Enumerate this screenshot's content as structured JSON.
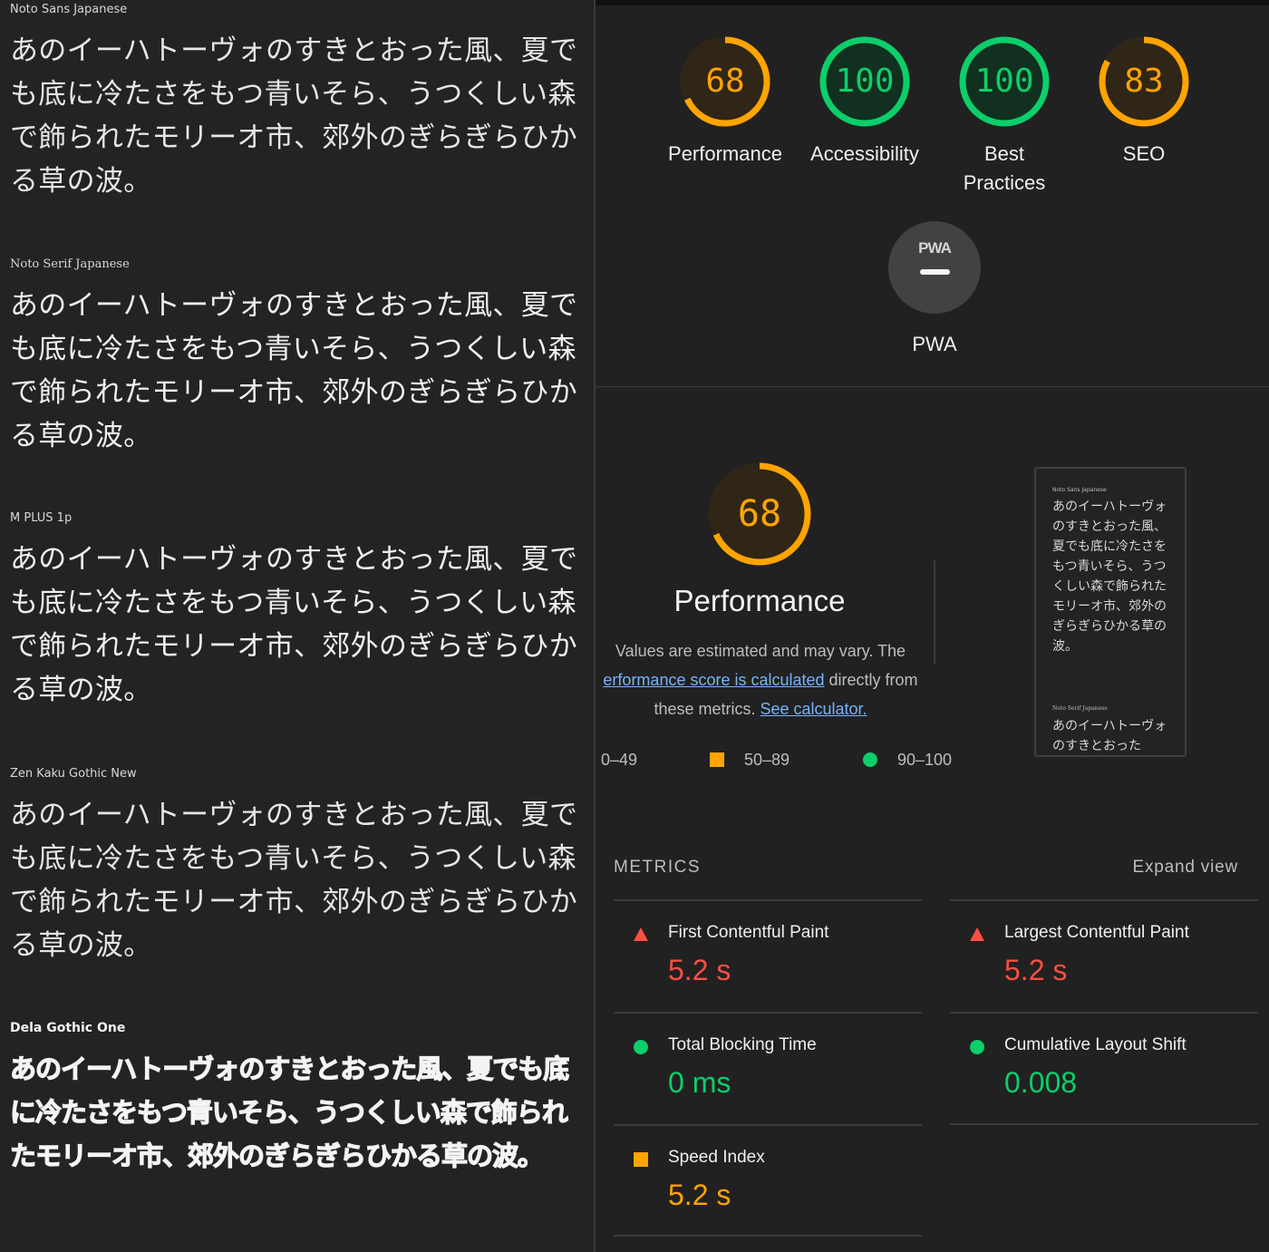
{
  "font_specimens": [
    {
      "font_name": "Noto Sans Japanese",
      "sample": "あのイーハトーヴォのすきとおった風、夏でも底に冷たさをもつ青いそら、うつくしい森で飾られたモリーオ市、郊外のぎらぎらひかる草の波。"
    },
    {
      "font_name": "Noto Serif Japanese",
      "sample": "あのイーハトーヴォのすきとおった風、夏でも底に冷たさをもつ青いそら、うつくしい森で飾られたモリーオ市、郊外のぎらぎらひかる草の波。"
    },
    {
      "font_name": "M PLUS 1p",
      "sample": "あのイーハトーヴォのすきとおった風、夏でも底に冷たさをもつ青いそら、うつくしい森で飾られたモリーオ市、郊外のぎらぎらひかる草の波。"
    },
    {
      "font_name": "Zen Kaku Gothic New",
      "sample": "あのイーハトーヴォのすきとおった風、夏でも底に冷たさをもつ青いそら、うつくしい森で飾られたモリーオ市、郊外のぎらぎらひかる草の波。"
    },
    {
      "font_name": "Dela Gothic One",
      "sample": "あのイーハトーヴォのすきとおった風、夏でも底に冷たさをもつ青いそら、うつくしい森で飾られたモリーオ市、郊外のぎらぎらひかる草の波。"
    }
  ],
  "report": {
    "categories": [
      {
        "label": "Performance",
        "score": "68",
        "score_value": 68,
        "rating": "average"
      },
      {
        "label": "Accessibility",
        "score": "100",
        "score_value": 100,
        "rating": "pass"
      },
      {
        "label": "Best Practices",
        "score": "100",
        "score_value": 100,
        "rating": "pass"
      },
      {
        "label": "SEO",
        "score": "83",
        "score_value": 83,
        "rating": "average"
      }
    ],
    "pwa": {
      "label": "PWA",
      "mark": "PWA"
    },
    "performance": {
      "score": "68",
      "score_value": 68,
      "title": "Performance",
      "desc_line1": "Values are estimated and may vary. The",
      "desc_link1": "erformance score is calculated",
      "desc_after_link1": " directly from",
      "desc_line3_prefix": "these metrics. ",
      "desc_link2": "See calculator.",
      "legend": [
        "0–49",
        "50–89",
        "90–100"
      ]
    },
    "screenshot_thumb": {
      "font_name_1": "Noto Sans Japanese",
      "text_1": "あのイーハトーヴォのすきとおった風、夏でも底に冷たさをもつ青いそら、うつくしい森で飾られたモリーオ市、郊外のぎらぎらひかる草の波。",
      "font_name_2": "Noto Serif Japanese",
      "text_2": "あのイーハトーヴォのすきとおった"
    },
    "metrics_heading": "METRICS",
    "expand_view": "Expand view",
    "metrics": [
      {
        "title": "First Contentful Paint",
        "value": "5.2 s",
        "rating": "fail",
        "icon": "triangle-icon"
      },
      {
        "title": "Largest Contentful Paint",
        "value": "5.2 s",
        "rating": "fail",
        "icon": "triangle-icon"
      },
      {
        "title": "Total Blocking Time",
        "value": "0 ms",
        "rating": "pass",
        "icon": "circle-icon"
      },
      {
        "title": "Cumulative Layout Shift",
        "value": "0.008",
        "rating": "pass",
        "icon": "circle-icon"
      },
      {
        "title": "Speed Index",
        "value": "5.2 s",
        "rating": "average",
        "icon": "square-icon"
      }
    ],
    "colors": {
      "fail": "#ff4e42",
      "average": "#ffa400",
      "pass": "#0cce6b",
      "link": "#76b3ff"
    }
  }
}
